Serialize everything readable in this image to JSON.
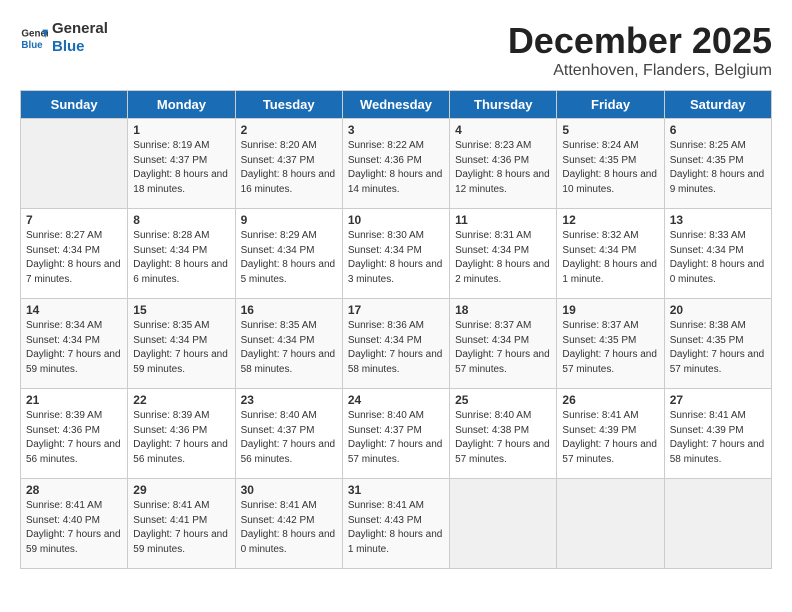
{
  "logo": {
    "line1": "General",
    "line2": "Blue"
  },
  "title": "December 2025",
  "location": "Attenhoven, Flanders, Belgium",
  "days_header": [
    "Sunday",
    "Monday",
    "Tuesday",
    "Wednesday",
    "Thursday",
    "Friday",
    "Saturday"
  ],
  "weeks": [
    [
      {
        "day": "",
        "sunrise": "",
        "sunset": "",
        "daylight": ""
      },
      {
        "day": "1",
        "sunrise": "Sunrise: 8:19 AM",
        "sunset": "Sunset: 4:37 PM",
        "daylight": "Daylight: 8 hours and 18 minutes."
      },
      {
        "day": "2",
        "sunrise": "Sunrise: 8:20 AM",
        "sunset": "Sunset: 4:37 PM",
        "daylight": "Daylight: 8 hours and 16 minutes."
      },
      {
        "day": "3",
        "sunrise": "Sunrise: 8:22 AM",
        "sunset": "Sunset: 4:36 PM",
        "daylight": "Daylight: 8 hours and 14 minutes."
      },
      {
        "day": "4",
        "sunrise": "Sunrise: 8:23 AM",
        "sunset": "Sunset: 4:36 PM",
        "daylight": "Daylight: 8 hours and 12 minutes."
      },
      {
        "day": "5",
        "sunrise": "Sunrise: 8:24 AM",
        "sunset": "Sunset: 4:35 PM",
        "daylight": "Daylight: 8 hours and 10 minutes."
      },
      {
        "day": "6",
        "sunrise": "Sunrise: 8:25 AM",
        "sunset": "Sunset: 4:35 PM",
        "daylight": "Daylight: 8 hours and 9 minutes."
      }
    ],
    [
      {
        "day": "7",
        "sunrise": "Sunrise: 8:27 AM",
        "sunset": "Sunset: 4:34 PM",
        "daylight": "Daylight: 8 hours and 7 minutes."
      },
      {
        "day": "8",
        "sunrise": "Sunrise: 8:28 AM",
        "sunset": "Sunset: 4:34 PM",
        "daylight": "Daylight: 8 hours and 6 minutes."
      },
      {
        "day": "9",
        "sunrise": "Sunrise: 8:29 AM",
        "sunset": "Sunset: 4:34 PM",
        "daylight": "Daylight: 8 hours and 5 minutes."
      },
      {
        "day": "10",
        "sunrise": "Sunrise: 8:30 AM",
        "sunset": "Sunset: 4:34 PM",
        "daylight": "Daylight: 8 hours and 3 minutes."
      },
      {
        "day": "11",
        "sunrise": "Sunrise: 8:31 AM",
        "sunset": "Sunset: 4:34 PM",
        "daylight": "Daylight: 8 hours and 2 minutes."
      },
      {
        "day": "12",
        "sunrise": "Sunrise: 8:32 AM",
        "sunset": "Sunset: 4:34 PM",
        "daylight": "Daylight: 8 hours and 1 minute."
      },
      {
        "day": "13",
        "sunrise": "Sunrise: 8:33 AM",
        "sunset": "Sunset: 4:34 PM",
        "daylight": "Daylight: 8 hours and 0 minutes."
      }
    ],
    [
      {
        "day": "14",
        "sunrise": "Sunrise: 8:34 AM",
        "sunset": "Sunset: 4:34 PM",
        "daylight": "Daylight: 7 hours and 59 minutes."
      },
      {
        "day": "15",
        "sunrise": "Sunrise: 8:35 AM",
        "sunset": "Sunset: 4:34 PM",
        "daylight": "Daylight: 7 hours and 59 minutes."
      },
      {
        "day": "16",
        "sunrise": "Sunrise: 8:35 AM",
        "sunset": "Sunset: 4:34 PM",
        "daylight": "Daylight: 7 hours and 58 minutes."
      },
      {
        "day": "17",
        "sunrise": "Sunrise: 8:36 AM",
        "sunset": "Sunset: 4:34 PM",
        "daylight": "Daylight: 7 hours and 58 minutes."
      },
      {
        "day": "18",
        "sunrise": "Sunrise: 8:37 AM",
        "sunset": "Sunset: 4:34 PM",
        "daylight": "Daylight: 7 hours and 57 minutes."
      },
      {
        "day": "19",
        "sunrise": "Sunrise: 8:37 AM",
        "sunset": "Sunset: 4:35 PM",
        "daylight": "Daylight: 7 hours and 57 minutes."
      },
      {
        "day": "20",
        "sunrise": "Sunrise: 8:38 AM",
        "sunset": "Sunset: 4:35 PM",
        "daylight": "Daylight: 7 hours and 57 minutes."
      }
    ],
    [
      {
        "day": "21",
        "sunrise": "Sunrise: 8:39 AM",
        "sunset": "Sunset: 4:36 PM",
        "daylight": "Daylight: 7 hours and 56 minutes."
      },
      {
        "day": "22",
        "sunrise": "Sunrise: 8:39 AM",
        "sunset": "Sunset: 4:36 PM",
        "daylight": "Daylight: 7 hours and 56 minutes."
      },
      {
        "day": "23",
        "sunrise": "Sunrise: 8:40 AM",
        "sunset": "Sunset: 4:37 PM",
        "daylight": "Daylight: 7 hours and 56 minutes."
      },
      {
        "day": "24",
        "sunrise": "Sunrise: 8:40 AM",
        "sunset": "Sunset: 4:37 PM",
        "daylight": "Daylight: 7 hours and 57 minutes."
      },
      {
        "day": "25",
        "sunrise": "Sunrise: 8:40 AM",
        "sunset": "Sunset: 4:38 PM",
        "daylight": "Daylight: 7 hours and 57 minutes."
      },
      {
        "day": "26",
        "sunrise": "Sunrise: 8:41 AM",
        "sunset": "Sunset: 4:39 PM",
        "daylight": "Daylight: 7 hours and 57 minutes."
      },
      {
        "day": "27",
        "sunrise": "Sunrise: 8:41 AM",
        "sunset": "Sunset: 4:39 PM",
        "daylight": "Daylight: 7 hours and 58 minutes."
      }
    ],
    [
      {
        "day": "28",
        "sunrise": "Sunrise: 8:41 AM",
        "sunset": "Sunset: 4:40 PM",
        "daylight": "Daylight: 7 hours and 59 minutes."
      },
      {
        "day": "29",
        "sunrise": "Sunrise: 8:41 AM",
        "sunset": "Sunset: 4:41 PM",
        "daylight": "Daylight: 7 hours and 59 minutes."
      },
      {
        "day": "30",
        "sunrise": "Sunrise: 8:41 AM",
        "sunset": "Sunset: 4:42 PM",
        "daylight": "Daylight: 8 hours and 0 minutes."
      },
      {
        "day": "31",
        "sunrise": "Sunrise: 8:41 AM",
        "sunset": "Sunset: 4:43 PM",
        "daylight": "Daylight: 8 hours and 1 minute."
      },
      {
        "day": "",
        "sunrise": "",
        "sunset": "",
        "daylight": ""
      },
      {
        "day": "",
        "sunrise": "",
        "sunset": "",
        "daylight": ""
      },
      {
        "day": "",
        "sunrise": "",
        "sunset": "",
        "daylight": ""
      }
    ]
  ]
}
